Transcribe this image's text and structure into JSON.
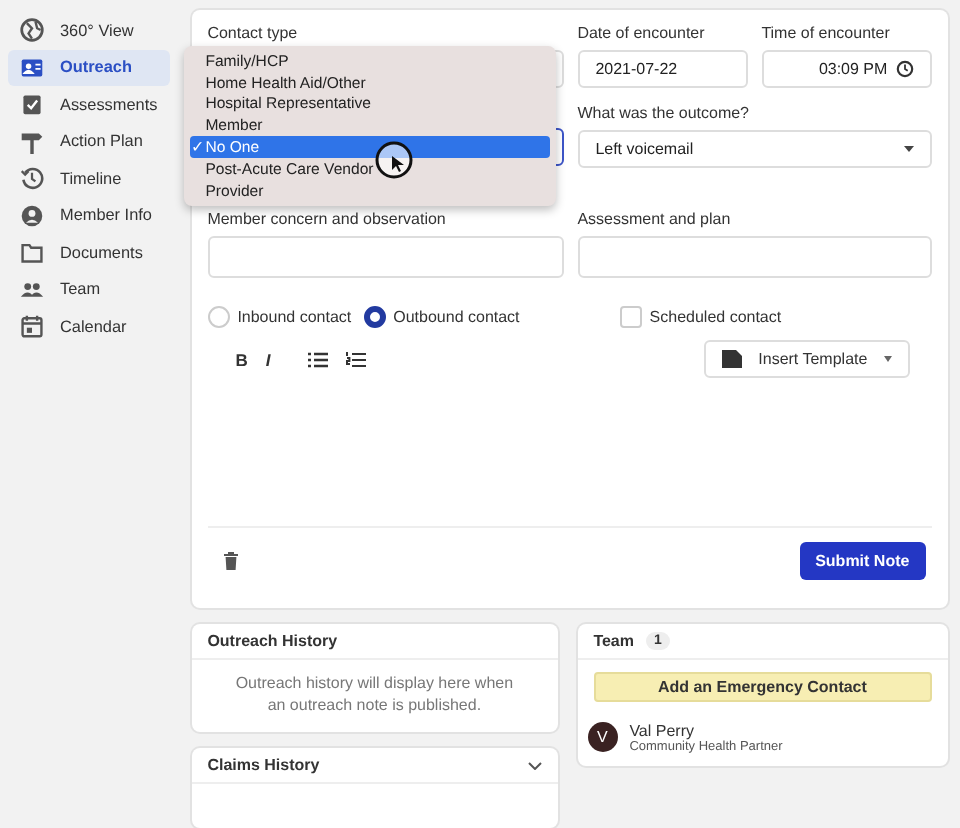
{
  "sidebar": {
    "items": [
      {
        "label": "360° View",
        "selected": false
      },
      {
        "label": "Outreach",
        "selected": true
      },
      {
        "label": "Assessments",
        "selected": false
      },
      {
        "label": "Action Plan",
        "selected": false
      },
      {
        "label": "Timeline",
        "selected": false
      },
      {
        "label": "Member Info",
        "selected": false
      },
      {
        "label": "Documents",
        "selected": false
      },
      {
        "label": "Team",
        "selected": false
      },
      {
        "label": "Calendar",
        "selected": false
      }
    ]
  },
  "note_form": {
    "contact_type": {
      "label": "Contact type",
      "options": [
        {
          "label": "Family/HCP",
          "selected": false
        },
        {
          "label": "Home Health Aid/Other",
          "selected": false
        },
        {
          "label": "Hospital Representative",
          "selected": false
        },
        {
          "label": "Member",
          "selected": false
        },
        {
          "label": "No One",
          "selected": true
        },
        {
          "label": "Post-Acute Care Vendor",
          "selected": false
        },
        {
          "label": "Provider",
          "selected": false
        }
      ],
      "check_mark": "✓"
    },
    "date": {
      "label": "Date of encounter",
      "value": "2021-07-22"
    },
    "time": {
      "label": "Time of encounter",
      "value": "03:09 PM"
    },
    "outcome": {
      "label": "What was the outcome?",
      "value": "Left voicemail"
    },
    "concern": {
      "label": "Member concern and observation"
    },
    "assessment": {
      "label": "Assessment and plan"
    },
    "direction": [
      {
        "label": "Inbound contact",
        "selected": false
      },
      {
        "label": "Outbound contact",
        "selected": true
      }
    ],
    "scheduled": {
      "label": "Scheduled contact",
      "checked": false
    },
    "toolbar": {
      "bold": "B",
      "italic": "I"
    },
    "insert_template": "Insert Template",
    "submit": "Submit Note"
  },
  "outreach_history": {
    "title": "Outreach History",
    "message": "Outreach history will display here when an outreach note is published."
  },
  "claims_history": {
    "title": "Claims History"
  },
  "team": {
    "title": "Team",
    "count": "1",
    "emergency_button": "Add an Emergency Contact",
    "members": [
      {
        "initial": "V",
        "name": "Val Perry",
        "role": "Community Health Partner"
      }
    ]
  }
}
